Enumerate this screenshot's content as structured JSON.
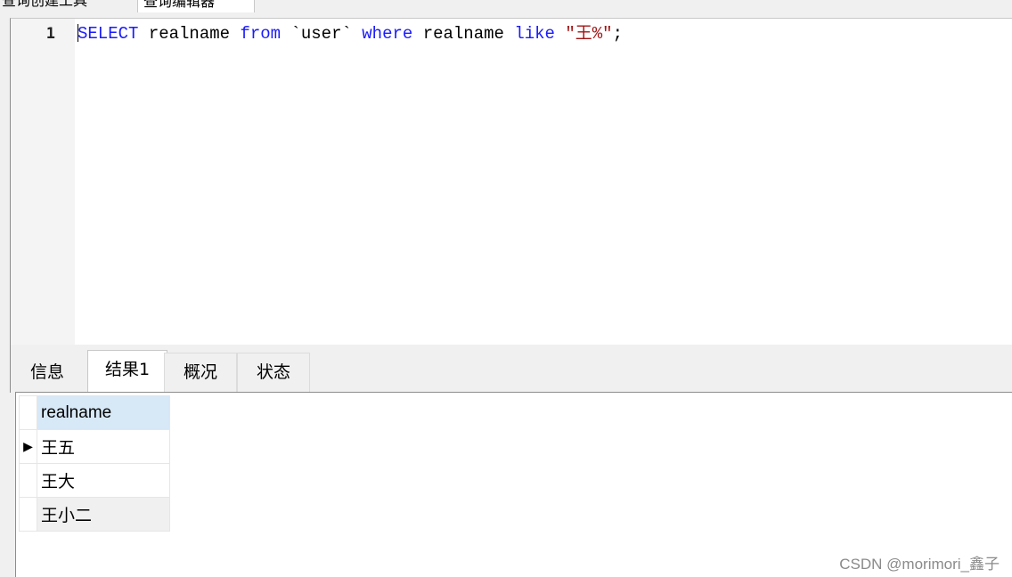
{
  "top_tabs": [
    {
      "label": "查询创建工具"
    },
    {
      "label": "查询编辑器"
    }
  ],
  "editor": {
    "line_number": "1",
    "tokens": {
      "select": "SELECT",
      "col1": " realname ",
      "from": "from",
      "table": " `user` ",
      "where": "where",
      "col2": " realname ",
      "like": "like",
      "space": " ",
      "pattern": "\"王%\"",
      "end": ";"
    }
  },
  "result_tabs": [
    {
      "label": "信息"
    },
    {
      "label": "结果1"
    },
    {
      "label": "概况"
    },
    {
      "label": "状态"
    }
  ],
  "result_grid": {
    "columns": [
      "realname"
    ],
    "current_row_marker": "▶",
    "rows": [
      {
        "realname": "王五"
      },
      {
        "realname": "王大"
      },
      {
        "realname": "王小二"
      }
    ]
  },
  "watermark": "CSDN @morimori_鑫子",
  "colors": {
    "keyword": "#1a1aff",
    "string": "#a31515",
    "header_bg": "#d7e8f7"
  }
}
